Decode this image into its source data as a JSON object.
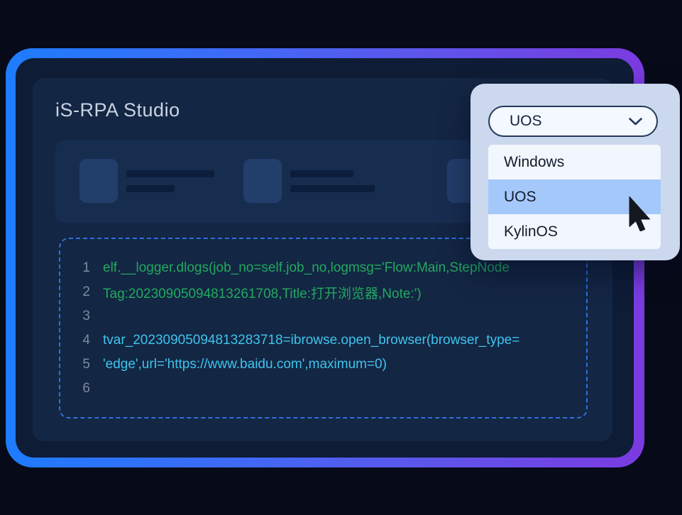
{
  "app": {
    "title": "iS-RPA Studio"
  },
  "dropdown": {
    "selected_value": "UOS",
    "options": [
      {
        "label": "Windows",
        "selected": false
      },
      {
        "label": "UOS",
        "selected": true
      },
      {
        "label": "KylinOS",
        "selected": false
      }
    ]
  },
  "code_editor": {
    "lines": [
      {
        "num": "1",
        "text": "elf.__logger.dlogs(job_no=self.job_no,logmsg='Flow:Main,StepNode",
        "kind": "log"
      },
      {
        "num": "2",
        "text": "Tag:20230905094813261708,Title:打开浏览器,Note:')",
        "kind": "log"
      },
      {
        "num": "3",
        "text": "",
        "kind": "empty"
      },
      {
        "num": "4",
        "text": "tvar_20230905094813283718=ibrowse.open_browser(browser_type=",
        "kind": "code"
      },
      {
        "num": "5",
        "text": "'edge',url='https://www.baidu.com',maximum=0)",
        "kind": "code"
      },
      {
        "num": "6",
        "text": "",
        "kind": "empty"
      }
    ]
  },
  "colors": {
    "frame_gradient_start": "#1E7CFF",
    "frame_gradient_end": "#7B3BE0",
    "panel_bg": "#0E1C36",
    "content_bg": "#132643",
    "dropdown_panel_bg": "#CBD8EE",
    "option_selected_bg": "#A4C8FA",
    "code_log_green": "#22A95F",
    "code_statement_cyan": "#3EC4EE",
    "dashed_border_blue": "#2E6FE0"
  }
}
